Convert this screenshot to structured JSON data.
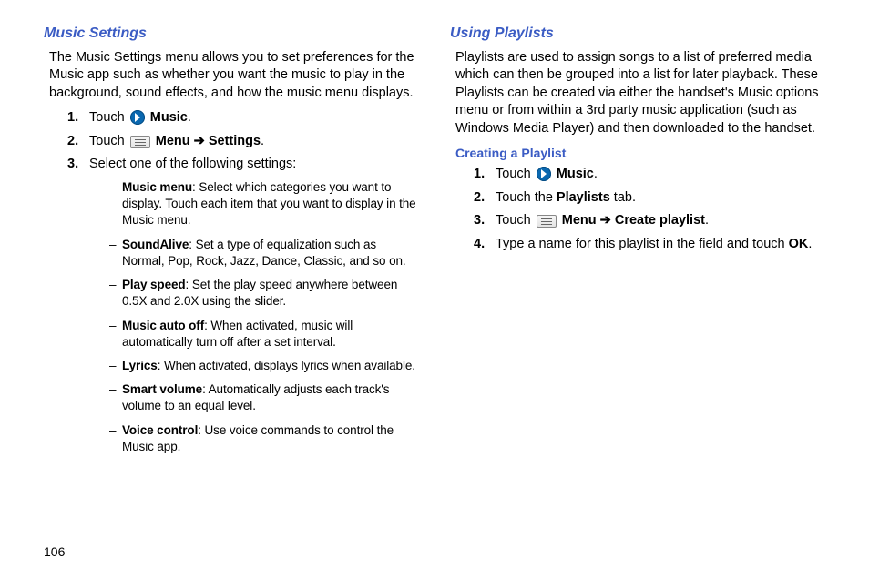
{
  "page_number": "106",
  "left": {
    "heading": "Music Settings",
    "intro": "The Music Settings menu allows you to set preferences for the Music app such as whether you want the music to play in the background, sound effects, and how the music menu displays.",
    "step1_pre": "Touch ",
    "step1_bold": "Music",
    "step1_post": ".",
    "step2_pre": "Touch ",
    "step2_menu": "Menu",
    "step2_arrow": " ➔ ",
    "step2_settings": "Settings",
    "step2_post": ".",
    "step3": "Select one of the following settings:",
    "bullets": {
      "b1_bold": "Music menu",
      "b1_rest": ": Select which categories you want to display. Touch each item that you want to display in the Music menu.",
      "b2_bold": "SoundAlive",
      "b2_rest": ": Set a type of equalization such as Normal, Pop, Rock, Jazz, Dance, Classic, and so on.",
      "b3_bold": "Play speed",
      "b3_rest": ": Set the play speed anywhere between 0.5X and 2.0X using the slider.",
      "b4_bold": "Music auto off",
      "b4_rest": ": When activated, music will automatically turn off after a set interval.",
      "b5_bold": "Lyrics",
      "b5_rest": ": When activated, displays lyrics when available.",
      "b6_bold": "Smart volume",
      "b6_rest": ": Automatically adjusts each track's volume to an equal level.",
      "b7_bold": "Voice control",
      "b7_rest": ": Use voice commands to control the Music app."
    }
  },
  "right": {
    "heading": "Using Playlists",
    "intro": "Playlists are used to assign songs to a list of preferred media which can then be grouped into a list for later playback. These Playlists can be created via either the handset's Music options menu or from within a 3rd party music application (such as Windows Media Player) and then downloaded to the handset.",
    "subheading": "Creating a Playlist",
    "step1_pre": "Touch ",
    "step1_bold": "Music",
    "step1_post": ".",
    "step2_pre": "Touch the ",
    "step2_bold": "Playlists",
    "step2_post": " tab.",
    "step3_pre": "Touch ",
    "step3_menu": "Menu",
    "step3_arrow": " ➔ ",
    "step3_create": "Create playlist",
    "step3_post": ".",
    "step4_pre": "Type a name for this playlist in the field and touch ",
    "step4_bold": "OK",
    "step4_post": "."
  }
}
